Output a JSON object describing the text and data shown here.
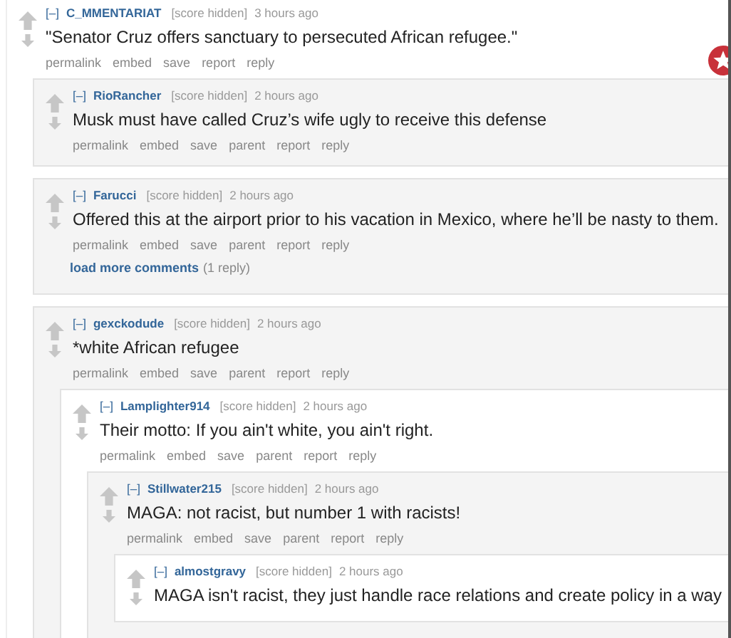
{
  "comments": [
    {
      "collapse": "[–]",
      "author": "C_MMENTARIAT",
      "score": "[score hidden]",
      "time": "3 hours ago",
      "body": "\"Senator Cruz offers sanctuary to persecuted African refugee.\"",
      "buttons": [
        "permalink",
        "embed",
        "save",
        "report",
        "reply"
      ],
      "children": [
        {
          "collapse": "[–]",
          "author": "RioRancher",
          "score": "[score hidden]",
          "time": "2 hours ago",
          "body": "Musk must have called Cruz’s wife ugly to receive this defense",
          "buttons": [
            "permalink",
            "embed",
            "save",
            "parent",
            "report",
            "reply"
          ]
        },
        {
          "collapse": "[–]",
          "author": "Farucci",
          "score": "[score hidden]",
          "time": "2 hours ago",
          "body": "Offered this at the airport prior to his vacation in Mexico, where he’ll be nasty to them.",
          "buttons": [
            "permalink",
            "embed",
            "save",
            "parent",
            "report",
            "reply"
          ],
          "load_more": {
            "link": "load more comments",
            "count": "(1 reply)"
          }
        },
        {
          "collapse": "[–]",
          "author": "gexckodude",
          "score": "[score hidden]",
          "time": "2 hours ago",
          "body": "*white African refugee",
          "buttons": [
            "permalink",
            "embed",
            "save",
            "parent",
            "report",
            "reply"
          ],
          "children": [
            {
              "collapse": "[–]",
              "author": "Lamplighter914",
              "score": "[score hidden]",
              "time": "2 hours ago",
              "body": "Their motto: If you ain't white, you ain't right.",
              "buttons": [
                "permalink",
                "embed",
                "save",
                "parent",
                "report",
                "reply"
              ],
              "children": [
                {
                  "collapse": "[–]",
                  "author": "Stillwater215",
                  "score": "[score hidden]",
                  "time": "2 hours ago",
                  "body": "MAGA: not racist, but number 1 with racists!",
                  "buttons": [
                    "permalink",
                    "embed",
                    "save",
                    "parent",
                    "report",
                    "reply"
                  ],
                  "children": [
                    {
                      "collapse": "[–]",
                      "author": "almostgravy",
                      "score": "[score hidden]",
                      "time": "2 hours ago",
                      "body": "MAGA isn't racist, they just handle race relations and create policy in a way"
                    }
                  ]
                }
              ]
            }
          ]
        }
      ]
    }
  ]
}
